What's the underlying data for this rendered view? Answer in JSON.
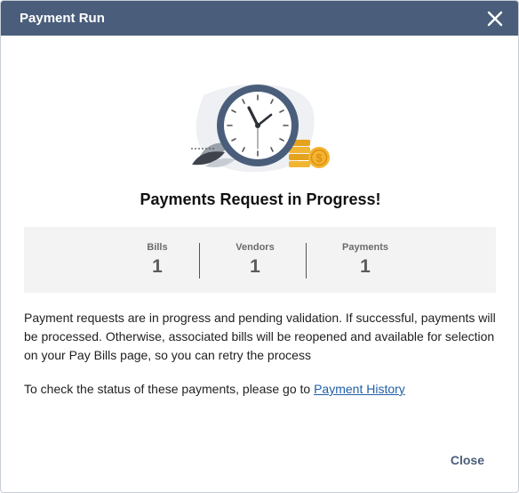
{
  "dialog": {
    "title": "Payment Run",
    "heading": "Payments Request in Progress!",
    "close_label": "Close"
  },
  "stats": [
    {
      "label": "Bills",
      "value": "1"
    },
    {
      "label": "Vendors",
      "value": "1"
    },
    {
      "label": "Payments",
      "value": "1"
    }
  ],
  "message": {
    "body": "Payment requests are in progress and pending validation. If successful, payments will be processed. Otherwise, associated bills will be reopened and available for selection on your Pay Bills page, so you can retry the process",
    "status_prefix": "To check the status of these payments, please go to ",
    "status_link": "Payment History"
  },
  "colors": {
    "titlebar": "#4a5e7b",
    "clock_ring": "#4a5e7b",
    "coin": "#f2b531",
    "link": "#1f5fa6"
  },
  "icons": {
    "close": "close-icon",
    "illustration": "clock-icon"
  }
}
